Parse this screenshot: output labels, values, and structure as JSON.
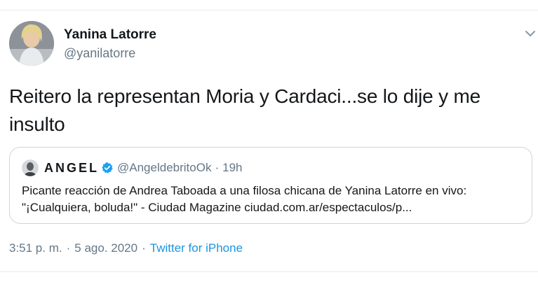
{
  "tweet": {
    "author_name": "Yanina Latorre",
    "author_handle": "@yanilatorre",
    "text": "Reitero la representan Moria y Cardaci...se lo dije y me insulto",
    "timestamp": "3:51 p. m.",
    "separator": "·",
    "date": "5 ago. 2020",
    "source": "Twitter for iPhone",
    "menu_icon": "chevron-down-icon"
  },
  "quoted_tweet": {
    "author_name": "ANGEL",
    "verified": true,
    "author_handle": "@AngeldebritoOk",
    "separator": "·",
    "time": "19h",
    "text": "Picante reacción de Andrea Taboada a una filosa chicana de Yanina Latorre en vivo: \"¡Cualquiera, boluda!\" - Ciudad Magazine ciudad.com.ar/espectaculos/p..."
  },
  "colors": {
    "link": "#1b95e0",
    "secondary_text": "#657786",
    "border": "#ccd6dd",
    "verified": "#1da1f2"
  }
}
